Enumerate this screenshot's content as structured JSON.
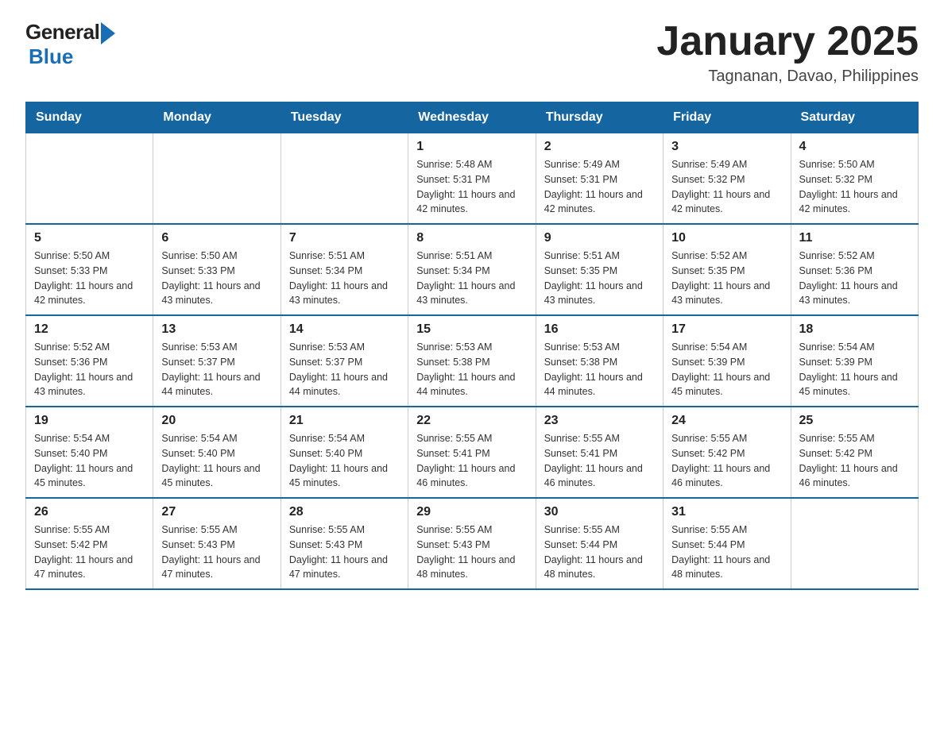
{
  "logo": {
    "general": "General",
    "blue": "Blue"
  },
  "title": "January 2025",
  "subtitle": "Tagnanan, Davao, Philippines",
  "weekdays": [
    "Sunday",
    "Monday",
    "Tuesday",
    "Wednesday",
    "Thursday",
    "Friday",
    "Saturday"
  ],
  "weeks": [
    [
      {
        "day": "",
        "sunrise": "",
        "sunset": "",
        "daylight": ""
      },
      {
        "day": "",
        "sunrise": "",
        "sunset": "",
        "daylight": ""
      },
      {
        "day": "",
        "sunrise": "",
        "sunset": "",
        "daylight": ""
      },
      {
        "day": "1",
        "sunrise": "Sunrise: 5:48 AM",
        "sunset": "Sunset: 5:31 PM",
        "daylight": "Daylight: 11 hours and 42 minutes."
      },
      {
        "day": "2",
        "sunrise": "Sunrise: 5:49 AM",
        "sunset": "Sunset: 5:31 PM",
        "daylight": "Daylight: 11 hours and 42 minutes."
      },
      {
        "day": "3",
        "sunrise": "Sunrise: 5:49 AM",
        "sunset": "Sunset: 5:32 PM",
        "daylight": "Daylight: 11 hours and 42 minutes."
      },
      {
        "day": "4",
        "sunrise": "Sunrise: 5:50 AM",
        "sunset": "Sunset: 5:32 PM",
        "daylight": "Daylight: 11 hours and 42 minutes."
      }
    ],
    [
      {
        "day": "5",
        "sunrise": "Sunrise: 5:50 AM",
        "sunset": "Sunset: 5:33 PM",
        "daylight": "Daylight: 11 hours and 42 minutes."
      },
      {
        "day": "6",
        "sunrise": "Sunrise: 5:50 AM",
        "sunset": "Sunset: 5:33 PM",
        "daylight": "Daylight: 11 hours and 43 minutes."
      },
      {
        "day": "7",
        "sunrise": "Sunrise: 5:51 AM",
        "sunset": "Sunset: 5:34 PM",
        "daylight": "Daylight: 11 hours and 43 minutes."
      },
      {
        "day": "8",
        "sunrise": "Sunrise: 5:51 AM",
        "sunset": "Sunset: 5:34 PM",
        "daylight": "Daylight: 11 hours and 43 minutes."
      },
      {
        "day": "9",
        "sunrise": "Sunrise: 5:51 AM",
        "sunset": "Sunset: 5:35 PM",
        "daylight": "Daylight: 11 hours and 43 minutes."
      },
      {
        "day": "10",
        "sunrise": "Sunrise: 5:52 AM",
        "sunset": "Sunset: 5:35 PM",
        "daylight": "Daylight: 11 hours and 43 minutes."
      },
      {
        "day": "11",
        "sunrise": "Sunrise: 5:52 AM",
        "sunset": "Sunset: 5:36 PM",
        "daylight": "Daylight: 11 hours and 43 minutes."
      }
    ],
    [
      {
        "day": "12",
        "sunrise": "Sunrise: 5:52 AM",
        "sunset": "Sunset: 5:36 PM",
        "daylight": "Daylight: 11 hours and 43 minutes."
      },
      {
        "day": "13",
        "sunrise": "Sunrise: 5:53 AM",
        "sunset": "Sunset: 5:37 PM",
        "daylight": "Daylight: 11 hours and 44 minutes."
      },
      {
        "day": "14",
        "sunrise": "Sunrise: 5:53 AM",
        "sunset": "Sunset: 5:37 PM",
        "daylight": "Daylight: 11 hours and 44 minutes."
      },
      {
        "day": "15",
        "sunrise": "Sunrise: 5:53 AM",
        "sunset": "Sunset: 5:38 PM",
        "daylight": "Daylight: 11 hours and 44 minutes."
      },
      {
        "day": "16",
        "sunrise": "Sunrise: 5:53 AM",
        "sunset": "Sunset: 5:38 PM",
        "daylight": "Daylight: 11 hours and 44 minutes."
      },
      {
        "day": "17",
        "sunrise": "Sunrise: 5:54 AM",
        "sunset": "Sunset: 5:39 PM",
        "daylight": "Daylight: 11 hours and 45 minutes."
      },
      {
        "day": "18",
        "sunrise": "Sunrise: 5:54 AM",
        "sunset": "Sunset: 5:39 PM",
        "daylight": "Daylight: 11 hours and 45 minutes."
      }
    ],
    [
      {
        "day": "19",
        "sunrise": "Sunrise: 5:54 AM",
        "sunset": "Sunset: 5:40 PM",
        "daylight": "Daylight: 11 hours and 45 minutes."
      },
      {
        "day": "20",
        "sunrise": "Sunrise: 5:54 AM",
        "sunset": "Sunset: 5:40 PM",
        "daylight": "Daylight: 11 hours and 45 minutes."
      },
      {
        "day": "21",
        "sunrise": "Sunrise: 5:54 AM",
        "sunset": "Sunset: 5:40 PM",
        "daylight": "Daylight: 11 hours and 45 minutes."
      },
      {
        "day": "22",
        "sunrise": "Sunrise: 5:55 AM",
        "sunset": "Sunset: 5:41 PM",
        "daylight": "Daylight: 11 hours and 46 minutes."
      },
      {
        "day": "23",
        "sunrise": "Sunrise: 5:55 AM",
        "sunset": "Sunset: 5:41 PM",
        "daylight": "Daylight: 11 hours and 46 minutes."
      },
      {
        "day": "24",
        "sunrise": "Sunrise: 5:55 AM",
        "sunset": "Sunset: 5:42 PM",
        "daylight": "Daylight: 11 hours and 46 minutes."
      },
      {
        "day": "25",
        "sunrise": "Sunrise: 5:55 AM",
        "sunset": "Sunset: 5:42 PM",
        "daylight": "Daylight: 11 hours and 46 minutes."
      }
    ],
    [
      {
        "day": "26",
        "sunrise": "Sunrise: 5:55 AM",
        "sunset": "Sunset: 5:42 PM",
        "daylight": "Daylight: 11 hours and 47 minutes."
      },
      {
        "day": "27",
        "sunrise": "Sunrise: 5:55 AM",
        "sunset": "Sunset: 5:43 PM",
        "daylight": "Daylight: 11 hours and 47 minutes."
      },
      {
        "day": "28",
        "sunrise": "Sunrise: 5:55 AM",
        "sunset": "Sunset: 5:43 PM",
        "daylight": "Daylight: 11 hours and 47 minutes."
      },
      {
        "day": "29",
        "sunrise": "Sunrise: 5:55 AM",
        "sunset": "Sunset: 5:43 PM",
        "daylight": "Daylight: 11 hours and 48 minutes."
      },
      {
        "day": "30",
        "sunrise": "Sunrise: 5:55 AM",
        "sunset": "Sunset: 5:44 PM",
        "daylight": "Daylight: 11 hours and 48 minutes."
      },
      {
        "day": "31",
        "sunrise": "Sunrise: 5:55 AM",
        "sunset": "Sunset: 5:44 PM",
        "daylight": "Daylight: 11 hours and 48 minutes."
      },
      {
        "day": "",
        "sunrise": "",
        "sunset": "",
        "daylight": ""
      }
    ]
  ]
}
